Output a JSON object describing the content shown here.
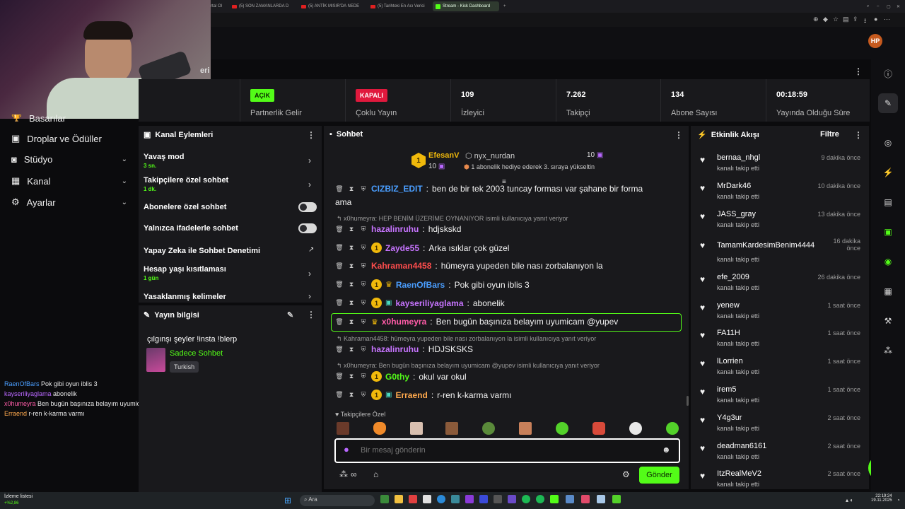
{
  "browser": {
    "tabs": [
      {
        "label": "rtal Ol",
        "active": false
      },
      {
        "label": "(5) SON ZAMANLARDA D",
        "active": false
      },
      {
        "label": "(5) ANTİK MISIR'DA NEDE",
        "active": false
      },
      {
        "label": "(5) Tarihteki En Acı Verici",
        "active": false
      },
      {
        "label": "Stream - Kick Dashboard",
        "active": true
      }
    ]
  },
  "dashboard": {
    "title_partial": "eri"
  },
  "stats": [
    {
      "badge": "AÇIK",
      "label": "Partnerlik Gelir"
    },
    {
      "badge": "KAPALI",
      "label": "Çoklu Yayın"
    },
    {
      "value": "109",
      "label": "İzleyici"
    },
    {
      "value": "7.262",
      "label": "Takipçi"
    },
    {
      "value": "134",
      "label": "Abone Sayısı"
    },
    {
      "value": "00:18:59",
      "label": "Yayında Olduğu Süre"
    }
  ],
  "sidebar": {
    "items": [
      {
        "label": "Başarılar"
      },
      {
        "label": "Droplar ve Ödüller"
      },
      {
        "label": "Stüdyo"
      },
      {
        "label": "Kanal"
      },
      {
        "label": "Ayarlar"
      }
    ]
  },
  "overlay_chat": [
    {
      "user": "RaenOfBars",
      "text": "Pok gibi oyun iblis 3",
      "color": "#4a9eff"
    },
    {
      "user": "kayseriliyaglama",
      "text": "abonelik",
      "color": "#b968ff"
    },
    {
      "user": "x0humeyra",
      "text": "Ben bugün başınıza belayım uyumicam @yupev",
      "color": "#ff5ca8"
    },
    {
      "user": "Erraend",
      "text": "r-ren k-karma varmı",
      "color": "#ffa94d"
    }
  ],
  "channel_actions": {
    "title": "Kanal Eylemleri",
    "items": [
      {
        "title": "Yavaş mod",
        "sub": "3 sn."
      },
      {
        "title": "Takipçilere özel sohbet",
        "sub": "1 dk."
      },
      {
        "title": "Abonelere özel sohbet"
      },
      {
        "title": "Yalnızca ifadelerle sohbet"
      },
      {
        "title": "Yapay Zeka ile Sohbet Denetimi"
      },
      {
        "title": "Hesap yaşı kısıtlaması",
        "sub": "1 gün"
      },
      {
        "title": "Yasaklanmış kelimeler"
      }
    ]
  },
  "stream_info": {
    "title": "Yayın bilgisi",
    "stream_title": "çılgınşı şeyler !insta !blerp",
    "category": "Sadece Sohbet",
    "language": "Turkish"
  },
  "chat": {
    "title": "Sohbet",
    "pinned": {
      "left_name": "EfesanV",
      "left_count": "10",
      "right_name": "nyx_nurdan",
      "right_count": "10",
      "sub_text": "1 abonelik hediye ederek 3. sıraya yükseltin"
    },
    "messages": [
      {
        "user": "CIZBIZ_EDIT",
        "text": "ben de bir tek 2003 tuncay forması var şahane bir forma",
        "color": "#4a9eff",
        "cont": "ama"
      },
      {
        "reply": "x0humeyra: HEP BENİM ÜZERİME OYNANIYOR isimli kullanıcıya yanıt veriyor"
      },
      {
        "user": "hazalinruhu",
        "text": "hdjskskd",
        "color": "#c774ff"
      },
      {
        "user": "Zayde55",
        "text": "Arka ısıklar çok güzel",
        "color": "#c774ff"
      },
      {
        "user": "Kahraman4458",
        "text": "hümeyra yupeden bile nası zorbalanıyon la",
        "color": "#ff4d4d"
      },
      {
        "user": "RaenOfBars",
        "text": "Pok gibi oyun iblis 3",
        "color": "#4a9eff"
      },
      {
        "user": "kayseriliyaglama",
        "text": "abonelik",
        "color": "#c774ff"
      },
      {
        "user": "x0humeyra",
        "text": "Ben bugün başınıza belayım uyumicam @yupev",
        "color": "#ff5ca8"
      },
      {
        "reply": "Kahraman4458: hümeyra yupeden bile nası zorbalanıyon la isimli kullanıcıya yanıt veriyor"
      },
      {
        "user": "hazalinruhu",
        "text": "HDJSKSKS",
        "color": "#c774ff"
      },
      {
        "reply": "x0humeyra: Ben bugün başınıza belayım uyumicam @yupev isimli kullanıcıya yanıt veriyor"
      },
      {
        "user": "G0thy",
        "text": "okul var okul",
        "color": "#53fc18"
      },
      {
        "user": "Erraend",
        "text": "r-ren k-karma varmı",
        "color": "#ffa94d"
      }
    ],
    "emote_label": "Takipçilere Özel",
    "input_placeholder": "Bir mesaj gönderin",
    "send_label": "Gönder"
  },
  "activity": {
    "title": "Etkinlik Akışı",
    "filter_label": "Filtre",
    "items": [
      {
        "name": "bernaa_nhgl",
        "action": "kanalı takip etti",
        "time": "9 dakika önce"
      },
      {
        "name": "MrDark46",
        "action": "kanalı takip etti",
        "time": "10 dakika önce"
      },
      {
        "name": "JASS_gray",
        "action": "kanalı takip etti",
        "time": "13 dakika önce"
      },
      {
        "name": "TamamKardesimBenim4444",
        "action": "kanalı takip etti",
        "time": "16 dakika önce"
      },
      {
        "name": "efe_2009",
        "action": "kanalı takip etti",
        "time": "26 dakika önce"
      },
      {
        "name": "yenew",
        "action": "kanalı takip etti",
        "time": "1 saat önce"
      },
      {
        "name": "FA11H",
        "action": "kanalı takip etti",
        "time": "1 saat önce"
      },
      {
        "name": "lLorrien",
        "action": "kanalı takip etti",
        "time": "1 saat önce"
      },
      {
        "name": "irem5",
        "action": "kanalı takip etti",
        "time": "1 saat önce"
      },
      {
        "name": "Y4g3ur",
        "action": "kanalı takip etti",
        "time": "2 saat önce"
      },
      {
        "name": "deadman6161",
        "action": "kanalı takip etti",
        "time": "2 saat önce"
      },
      {
        "name": "ItzRealMeV2",
        "action": "kanalı takip etti",
        "time": "2 saat önce"
      }
    ]
  },
  "taskbar": {
    "widget_title": "İzleme listesi",
    "widget_value": "+%2,86",
    "search_placeholder": "Ara",
    "time": "22:19:24",
    "date": "19.11.2025"
  }
}
